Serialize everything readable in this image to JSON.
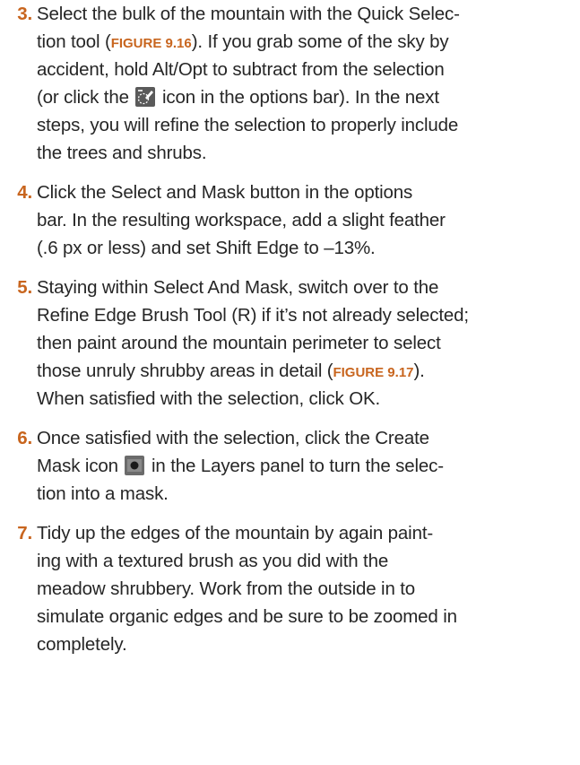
{
  "icons": {
    "subtract_selection": "quick-selection-subtract-icon",
    "create_mask": "create-mask-icon"
  },
  "colors": {
    "accent": "#c8651e",
    "text": "#262626"
  },
  "steps": [
    {
      "number": "3.",
      "lines": [
        {
          "a": "Select the bulk of the mountain with the Quick Selec-"
        },
        {
          "a": "tion tool (",
          "fig": "FIGURE 9.16",
          "b": "). If you grab some of the sky by"
        },
        {
          "a": "accident, hold Alt/Opt to subtract from the selection"
        },
        {
          "a": "(or click the",
          "b": "icon in the options bar). In the next"
        },
        {
          "a": "steps, you will refine the selection to properly include"
        },
        {
          "a": "the trees and shrubs."
        }
      ]
    },
    {
      "number": "4.",
      "lines": [
        {
          "a": "Click the Select and Mask button in the options"
        },
        {
          "a": "bar. In the resulting workspace, add a slight feather"
        },
        {
          "a": "(.6 px or less) and set Shift Edge to –13%."
        }
      ]
    },
    {
      "number": "5.",
      "lines": [
        {
          "a": "Staying within Select And Mask, switch over to the"
        },
        {
          "a": "Refine Edge Brush Tool (R) if it’s not already selected;"
        },
        {
          "a": "then paint around the mountain perimeter to select"
        },
        {
          "a": "those unruly shrubby areas in detail (",
          "fig": "FIGURE 9.17",
          "b": ")."
        },
        {
          "a": "When satisfied with the selection, click OK."
        }
      ]
    },
    {
      "number": "6.",
      "lines": [
        {
          "a": "Once satisfied with the selection, click the Create"
        },
        {
          "a": "Mask icon",
          "b": "in the Layers panel to turn the selec-"
        },
        {
          "a": "tion into a mask."
        }
      ]
    },
    {
      "number": "7.",
      "lines": [
        {
          "a": "Tidy up the edges of the mountain by again paint-"
        },
        {
          "a": "ing with a textured brush as you did with the"
        },
        {
          "a": "meadow shrubbery. Work from the outside in to"
        },
        {
          "a": "simulate organic edges and be sure to be zoomed in"
        },
        {
          "a": "completely."
        }
      ]
    }
  ]
}
